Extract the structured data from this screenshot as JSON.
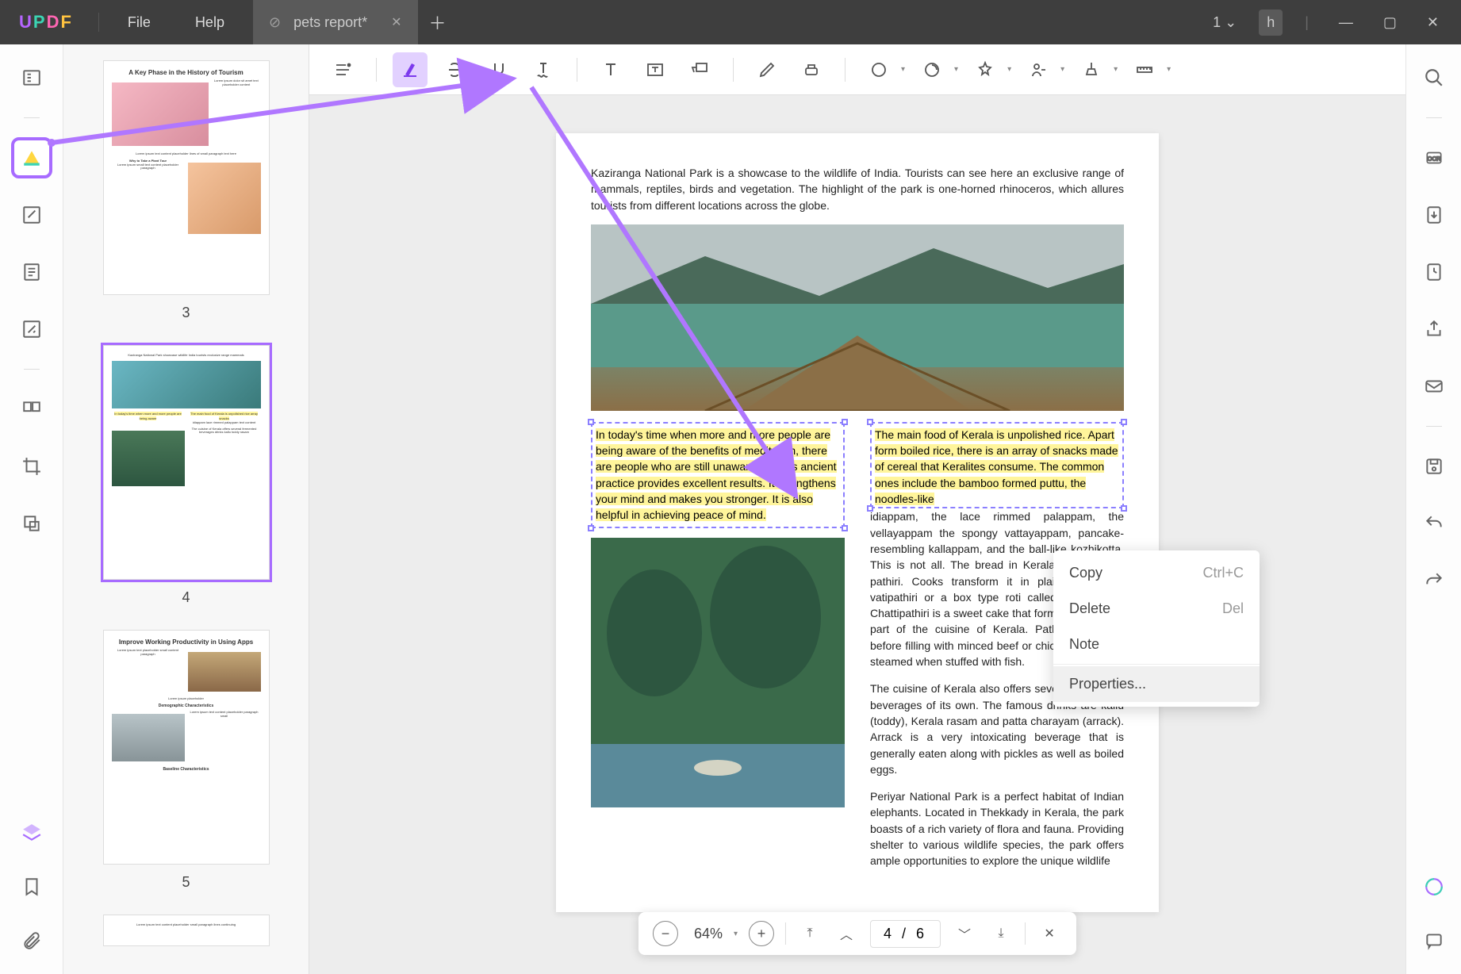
{
  "app": {
    "logo": "UPDF",
    "menus": [
      "File",
      "Help"
    ]
  },
  "tab": {
    "title": "pets report*"
  },
  "window": {
    "count_label": "1",
    "user_initial": "h"
  },
  "toolbar_icons": [
    "comment-list",
    "highlight",
    "strikethrough",
    "underline",
    "squiggly",
    "text",
    "textbox",
    "callout",
    "pencil",
    "eraser",
    "shape",
    "stamp",
    "sticky-note",
    "signature",
    "distance",
    "measure"
  ],
  "thumbnails": [
    {
      "num": "3",
      "title": "A Key Phase in the History of Tourism"
    },
    {
      "num": "4",
      "title": ""
    },
    {
      "num": "5",
      "title": "Improve Working Productivity in Using Apps"
    }
  ],
  "page": {
    "intro": "Kaziranga National Park is a showcase to the wildlife of India. Tourists can see here an exclusive range of mammals, reptiles, birds and vegetation. The highlight of the park is one-horned rhinoceros, which allures tourists from different locations across the globe.",
    "left_hl": "In today's time when more and more people are being aware of the benefits of meditation, there are people who are still unaware that this ancient practice provides excellent results. It strengthens your mind and makes you stronger. It is also helpful in achieving peace of mind.",
    "right_hl": "The main food of Kerala is unpolished rice. Apart form boiled rice, there is an array of snacks made of cereal that Keralites consume. The common ones include the bamboo formed puttu, the noodles-like",
    "right_rest": "idiappam, the lace rimmed palappam, the vellayappam the spongy vattayappam, pancake-resembling kallappam, and the ball-like kozhikotta. This is not all. The bread in Kerala is called the pathiri. Cooks transform it in plain thin bread vatipathiri or a box type roti called petti pathiri. Chattipathiri is a sweet cake that forms a significant part of the cuisine of Kerala. Pathiris are fried before filling with minced beef or chicken. They are steamed when stuffed with fish.",
    "para3": "The cuisine of Kerala also offers several fermented beverages of its own. The famous drinks are kallu (toddy), Kerala rasam and patta charayam (arrack). Arrack is a very intoxicating beverage that is generally eaten along with pickles as well as boiled eggs.",
    "para4": "Periyar National Park is a perfect habitat of Indian elephants. Located in Thekkady in Kerala, the park boasts of a rich variety of flora and fauna. Providing shelter to various wildlife species, the park offers ample opportunities to explore the unique wildlife"
  },
  "context_menu": {
    "items": [
      {
        "label": "Copy",
        "shortcut": "Ctrl+C"
      },
      {
        "label": "Delete",
        "shortcut": "Del"
      },
      {
        "label": "Note",
        "shortcut": ""
      },
      {
        "label": "Properties...",
        "shortcut": ""
      }
    ]
  },
  "bottom": {
    "zoom": "64%",
    "page": "4 / 6"
  }
}
